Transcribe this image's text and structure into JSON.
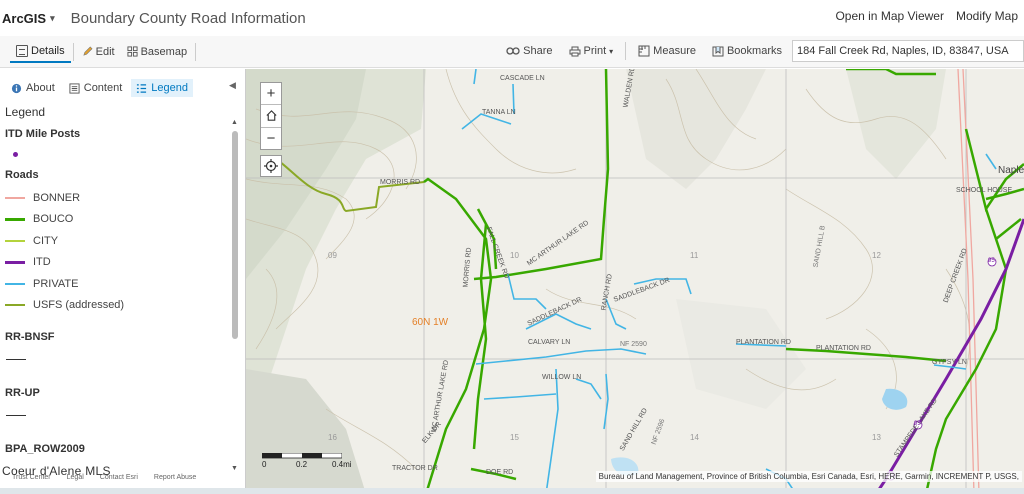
{
  "app": {
    "brand": "ArcGIS",
    "title": "Boundary County Road Information"
  },
  "top_links": {
    "open_viewer": "Open in Map Viewer",
    "modify": "Modify Map"
  },
  "toolbar": {
    "details": "Details",
    "edit": "Edit",
    "basemap": "Basemap",
    "share": "Share",
    "print": "Print",
    "measure": "Measure",
    "bookmarks": "Bookmarks",
    "address": "184 Fall Creek Rd, Naples, ID, 83847, USA"
  },
  "sidebar": {
    "tabs": {
      "about": "About",
      "content": "Content",
      "legend": "Legend"
    },
    "legend_heading": "Legend",
    "mileposts_title": "ITD Mile Posts",
    "roads_title": "Roads",
    "roads": [
      {
        "label": "BONNER",
        "color": "#f0a7a0"
      },
      {
        "label": "BOUCO",
        "color": "#38a800"
      },
      {
        "label": "CITY",
        "color": "#b4d33c"
      },
      {
        "label": "ITD",
        "color": "#7a1ea3"
      },
      {
        "label": "PRIVATE",
        "color": "#42b5e5"
      },
      {
        "label": "USFS (addressed)",
        "color": "#8aa826"
      }
    ],
    "rr_bnsf": "RR-BNSF",
    "rr_up": "RR-UP",
    "bpa": "BPA_ROW2009",
    "footer": {
      "trust": "Trust Center",
      "legal": "Legal",
      "contact": "Contact Esri",
      "report": "Report Abuse"
    },
    "watermark": "Coeur d'Alene MLS"
  },
  "map": {
    "zone_label": "60N 1W",
    "scale_labels": [
      "0",
      "0.2",
      "0.4mi"
    ],
    "attribution": "Bureau of Land Management, Province of British Columbia, Esri Canada, Esri, HERE, Garmin, INCREMENT P, USGS,",
    "road_labels": [
      "CASCADE LN",
      "TANNA LN",
      "MORRIS RD",
      "FALL CREEK RD",
      "MC ARTHUR LAKE RD",
      "SADDLEBACK DR",
      "SADDLEBACK DR",
      "RANCH RD",
      "CALVARY LN",
      "WILLOW LN",
      "PLANTATION RD",
      "PLANTATION RD",
      "GYPSY LN",
      "STAMPEDE LAKE RD",
      "DOE RD",
      "TRACTOR DR",
      "ELK DR",
      "SAND HILL RD",
      "DEEP CREEK RD",
      "SAND HILL B",
      "MORRIS RD",
      "MC ARTHUR LAKE RD",
      "WALDEN RD",
      "NF 2596",
      "NF 2590",
      "SCHOOL HOUSE",
      "Naple"
    ],
    "section_numbers": [
      "09",
      "10",
      "11",
      "12",
      "13",
      "14",
      "15",
      "16"
    ],
    "shield_labels": [
      "95",
      "95",
      "95"
    ],
    "colors": {
      "bouco": "#38a800",
      "private": "#42b5e5",
      "itd": "#7a1ea3",
      "usfs": "#8aa826",
      "city": "#b4d33c",
      "bonner": "#f0a7a0"
    }
  }
}
